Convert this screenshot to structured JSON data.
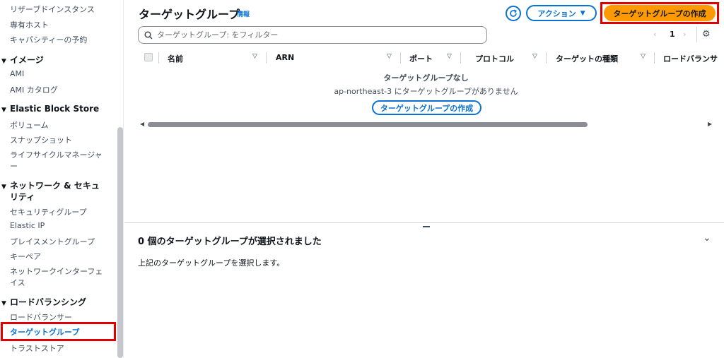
{
  "sidebar": {
    "items_top": [
      "リザーブドインスタンス",
      "専有ホスト",
      "キャパシティーの予約"
    ],
    "sections": [
      {
        "title": "イメージ",
        "items": [
          "AMI",
          "AMI カタログ"
        ]
      },
      {
        "title": "Elastic Block Store",
        "items": [
          "ボリューム",
          "スナップショット",
          "ライフサイクルマネージャ",
          "ー"
        ]
      },
      {
        "title_line1": "ネットワーク & セキュ",
        "title_line2": "リティ",
        "items": [
          "セキュリティグループ",
          "Elastic IP",
          "プレイスメントグループ",
          "キーペア",
          "ネットワークインターフェ",
          "イス"
        ]
      },
      {
        "title": "ロードバランシング",
        "items": [
          "ロードバランサー",
          "ターゲットグループ",
          "トラストストア"
        ]
      }
    ]
  },
  "header": {
    "title": "ターゲットグループ",
    "info": "情報",
    "actions_label": "アクション",
    "create_label": "ターゲットグループの作成"
  },
  "search": {
    "placeholder": "ターゲットグループ: をフィルター"
  },
  "pagination": {
    "prev": "‹",
    "page": "1",
    "next": "›"
  },
  "table": {
    "columns": [
      "名前",
      "ARN",
      "ポート",
      "プロトコル",
      "ターゲットの種類",
      "ロードバランサ"
    ],
    "empty_title": "ターゲットグループなし",
    "empty_subtitle": "ap-northeast-3 にターゲットグループがありません",
    "empty_button": "ターゲットグループの作成"
  },
  "split_panel": {
    "title": "0 個のターゲットグループが選択されました",
    "description": "上記のターゲットグループを選択します。"
  },
  "colors": {
    "accent": "#0972d3",
    "primary_button": "#ff9900",
    "highlight": "#e00000"
  }
}
